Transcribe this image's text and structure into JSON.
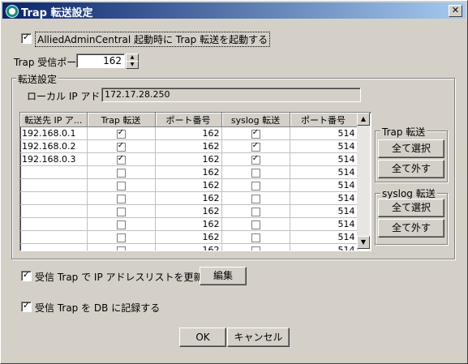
{
  "window": {
    "title": "Trap 転送設定",
    "close_glyph": "✕"
  },
  "options": {
    "start_on_launch": {
      "label": "AlliedAdminCentral 起動時に Trap 転送を起動する",
      "checked": true
    },
    "receive_port": {
      "label": "Trap 受信ポート",
      "value": "162"
    }
  },
  "forward_settings": {
    "group_label": "転送設定",
    "local_ip_label": "ローカル IP アドレス",
    "local_ip_value": "172.17.28.250",
    "columns": [
      "転送先 IP ア...",
      "Trap 転送",
      "ポート番号",
      "syslog 転送",
      "ポート番号"
    ],
    "rows": [
      {
        "ip": "192.168.0.1",
        "trap": true,
        "trap_port": "162",
        "syslog": true,
        "syslog_port": "514"
      },
      {
        "ip": "192.168.0.2",
        "trap": true,
        "trap_port": "162",
        "syslog": true,
        "syslog_port": "514"
      },
      {
        "ip": "192.168.0.3",
        "trap": true,
        "trap_port": "162",
        "syslog": true,
        "syslog_port": "514"
      },
      {
        "ip": "",
        "trap": false,
        "trap_port": "162",
        "syslog": false,
        "syslog_port": "514"
      },
      {
        "ip": "",
        "trap": false,
        "trap_port": "162",
        "syslog": false,
        "syslog_port": "514"
      },
      {
        "ip": "",
        "trap": false,
        "trap_port": "162",
        "syslog": false,
        "syslog_port": "514"
      },
      {
        "ip": "",
        "trap": false,
        "trap_port": "162",
        "syslog": false,
        "syslog_port": "514"
      },
      {
        "ip": "",
        "trap": false,
        "trap_port": "162",
        "syslog": false,
        "syslog_port": "514"
      },
      {
        "ip": "",
        "trap": false,
        "trap_port": "162",
        "syslog": false,
        "syslog_port": "514"
      },
      {
        "ip": "",
        "trap": false,
        "trap_port": "162",
        "syslog": false,
        "syslog_port": "514"
      }
    ],
    "trap_group": {
      "label": "Trap 転送",
      "select_all": "全て選択",
      "deselect_all": "全て外す"
    },
    "syslog_group": {
      "label": "syslog 転送",
      "select_all": "全て選択",
      "deselect_all": "全て外す"
    }
  },
  "update_list": {
    "label": "受信 Trap で IP アドレスリストを更新する",
    "checked": true,
    "edit_button": "編集"
  },
  "log_db": {
    "label": "受信 Trap を DB に記録する",
    "checked": true
  },
  "footer": {
    "ok": "OK",
    "cancel": "キャンセル"
  }
}
